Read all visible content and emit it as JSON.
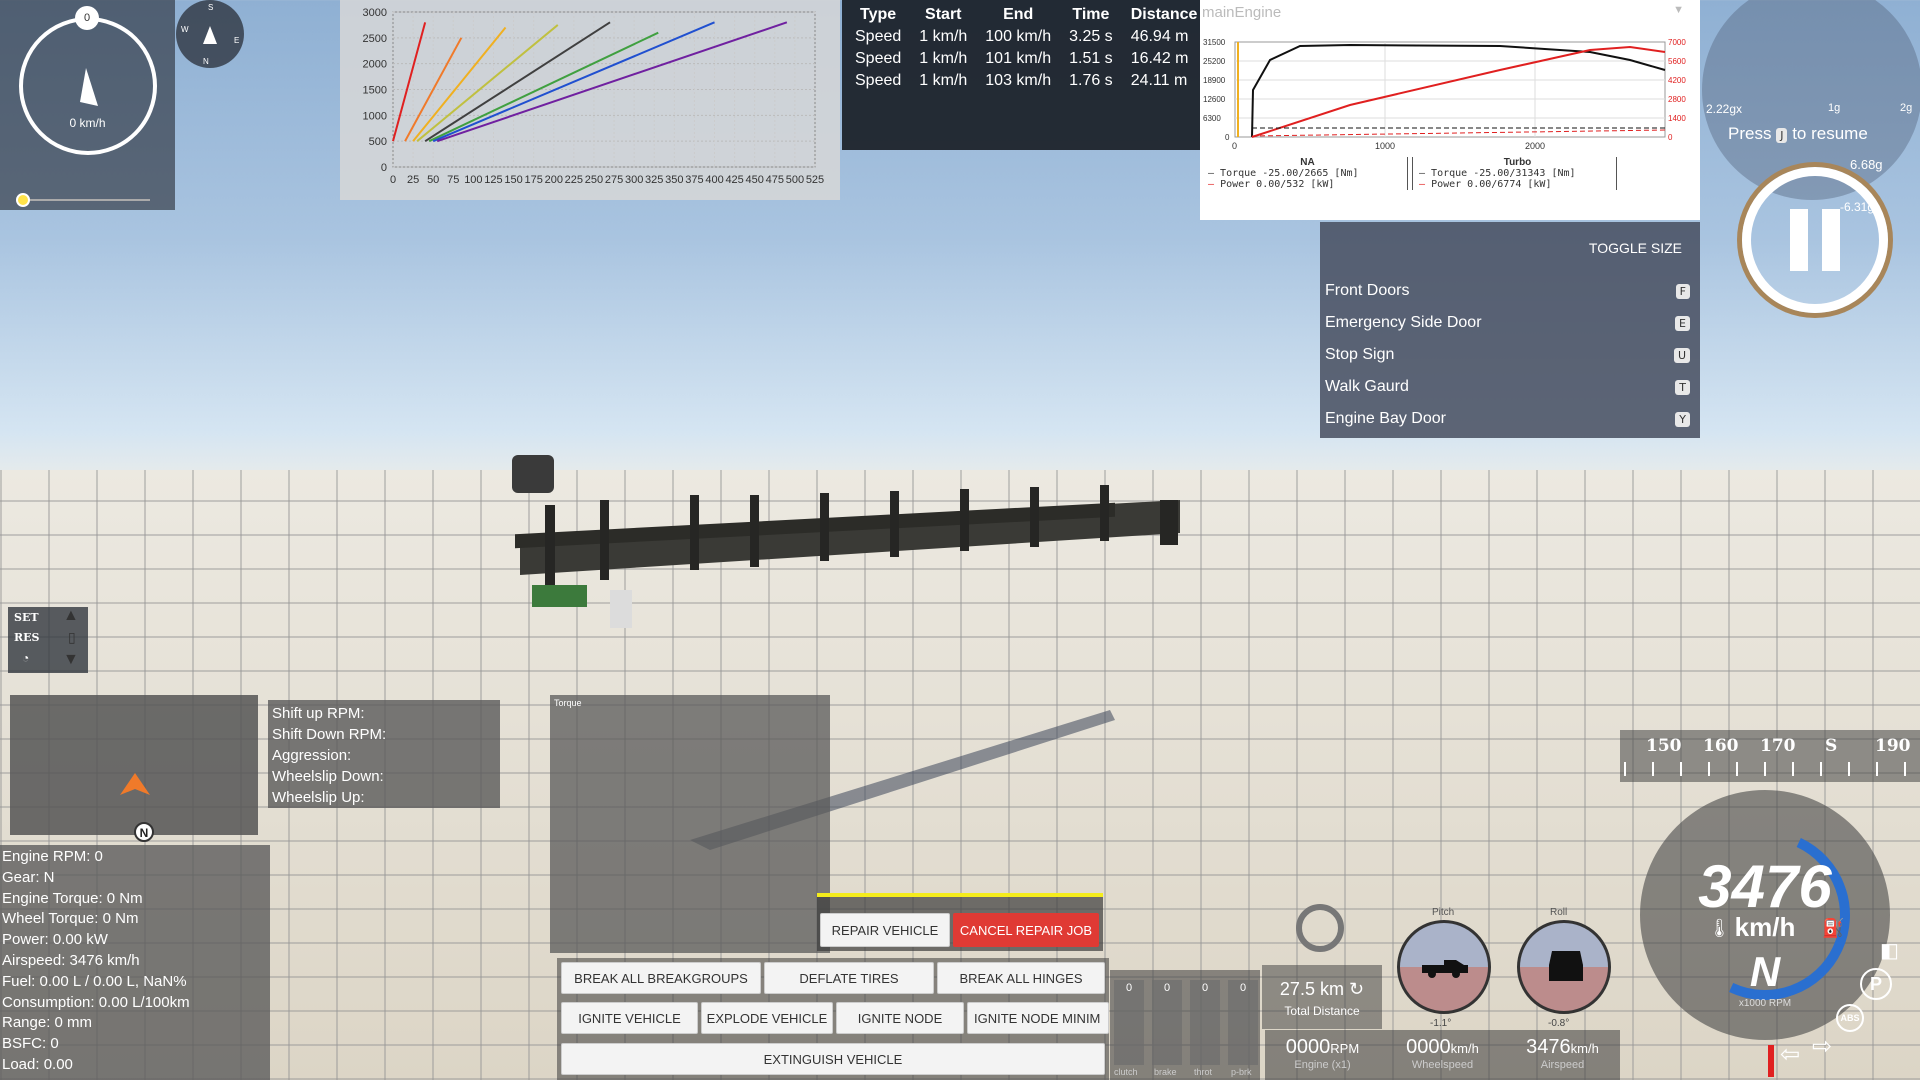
{
  "compass": {
    "speed": "0 km/h",
    "top_label": "0",
    "mini": {
      "n": "N",
      "s": "S",
      "e": "E",
      "w": "W"
    }
  },
  "accel_chart": {
    "yticks": [
      "3000",
      "2500",
      "2000",
      "1500",
      "1000",
      "500",
      "0"
    ],
    "xticks": [
      "0",
      "25",
      "50",
      "75",
      "100",
      "125",
      "150",
      "175",
      "200",
      "225",
      "250",
      "275",
      "300",
      "325",
      "350",
      "375",
      "400",
      "425",
      "450",
      "475",
      "500",
      "525"
    ]
  },
  "chart_data": {
    "type": "line",
    "title": "",
    "xlabel": "",
    "ylabel": "",
    "xlim": [
      0,
      525
    ],
    "ylim": [
      0,
      3000
    ],
    "series": [
      {
        "color": "#e02020",
        "x": [
          0,
          40
        ],
        "y": [
          500,
          2800
        ]
      },
      {
        "color": "#f07a2a",
        "x": [
          15,
          85
        ],
        "y": [
          500,
          2500
        ]
      },
      {
        "color": "#f0b020",
        "x": [
          25,
          140
        ],
        "y": [
          500,
          2700
        ]
      },
      {
        "color": "#c0c040",
        "x": [
          30,
          205
        ],
        "y": [
          500,
          2750
        ]
      },
      {
        "color": "#404040",
        "x": [
          40,
          270
        ],
        "y": [
          500,
          2800
        ]
      },
      {
        "color": "#40a040",
        "x": [
          45,
          330
        ],
        "y": [
          500,
          2600
        ]
      },
      {
        "color": "#2050d0",
        "x": [
          50,
          400
        ],
        "y": [
          500,
          2800
        ]
      },
      {
        "color": "#7020a0",
        "x": [
          55,
          490
        ],
        "y": [
          500,
          2800
        ]
      }
    ]
  },
  "results": {
    "headers": [
      "Type",
      "Start",
      "End",
      "Time",
      "Distance"
    ],
    "rows": [
      [
        "Speed",
        "1 km/h",
        "100 km/h",
        "3.25 s",
        "46.94 m"
      ],
      [
        "Speed",
        "1 km/h",
        "101 km/h",
        "1.51 s",
        "16.42 m"
      ],
      [
        "Speed",
        "1 km/h",
        "103 km/h",
        "1.76 s",
        "24.11 m"
      ]
    ]
  },
  "engine": {
    "selector": "mainEngine",
    "yleft": [
      "31500",
      "25200",
      "18900",
      "12600",
      "6300",
      "0"
    ],
    "yright": [
      "7000",
      "5600",
      "4200",
      "2800",
      "1400",
      "0"
    ],
    "xticks": [
      "0",
      "1000",
      "2000"
    ],
    "na": {
      "title": "NA",
      "torque": "Torque -25.00/2665 [Nm]",
      "power": "Power  0.00/532  [kW]"
    },
    "turbo": {
      "title": "Turbo",
      "torque": "Torque -25.00/31343 [Nm]",
      "power": "Power  0.00/6774  [kW]"
    }
  },
  "pause": {
    "press": "Press",
    "key": "J",
    "resume": "to resume",
    "g1": "2.22gx",
    "g2": "6.68g",
    "g3": "-6.31gy",
    "g4": "1g",
    "g5": "2g"
  },
  "doors": {
    "toggle": "TOGGLE SIZE",
    "items": [
      {
        "label": "Front Doors",
        "key": "F"
      },
      {
        "label": "Emergency Side Door",
        "key": "E"
      },
      {
        "label": "Stop Sign",
        "key": "U"
      },
      {
        "label": "Walk Gaurd",
        "key": "T"
      },
      {
        "label": "Engine Bay Door",
        "key": "Y"
      }
    ]
  },
  "cruise": {
    "set": "SET",
    "res": "RES"
  },
  "minimap": {
    "north": "N"
  },
  "shift": {
    "up": "Shift up RPM:",
    "down": "Shift Down RPM:",
    "aggr": "Aggression:",
    "wsd": "Wheelslip Down:",
    "wsu": "Wheelslip Up:"
  },
  "torque_graph": {
    "title": "Torque"
  },
  "stats": [
    "Engine RPM: 0",
    "Gear: N",
    "Engine Torque: 0 Nm",
    "Wheel Torque: 0 Nm",
    "Power: 0.00 kW",
    "Airspeed: 3476 km/h",
    "Fuel: 0.00 L / 0.00 L, NaN%",
    "Consumption: 0.00 L/100km",
    "Range: 0 mm",
    "BSFC: 0",
    "Load: 0.00"
  ],
  "repair": {
    "repair": "REPAIR VEHICLE",
    "cancel": "CANCEL REPAIR JOB"
  },
  "actions": {
    "b1": "BREAK ALL BREAKGROUPS",
    "b2": "DEFLATE TIRES",
    "b3": "BREAK ALL HINGES",
    "b4": "IGNITE VEHICLE",
    "b5": "EXPLODE VEHICLE",
    "b6": "IGNITE NODE",
    "b7": "IGNITE NODE MINIM",
    "b8": "EXTINGUISH VEHICLE"
  },
  "inputs": {
    "vals": [
      "0",
      "0",
      "0",
      "0"
    ],
    "labels": [
      "clutch",
      "brake",
      "throt",
      "p-brk"
    ]
  },
  "trip": {
    "dist": "27.5 km",
    "label": "Total Distance"
  },
  "attitude": {
    "pitch": "Pitch",
    "roll": "Roll",
    "pitch_val": "-1.1°",
    "roll_val": "-0.8°"
  },
  "readouts": [
    {
      "val": "0000",
      "unit": "RPM",
      "label": "Engine (x1)"
    },
    {
      "val": "0000",
      "unit": "km/h",
      "label": "Wheelspeed"
    },
    {
      "val": "3476",
      "unit": "km/h",
      "label": "Airspeed"
    }
  ],
  "heading": {
    "ticks": [
      "150",
      "160",
      "170",
      "S",
      "190"
    ]
  },
  "speedo": {
    "speed": "3476",
    "unit": "km/h",
    "gear": "N",
    "rpm": "x1000 RPM",
    "p": "P",
    "abs": "ABS"
  }
}
